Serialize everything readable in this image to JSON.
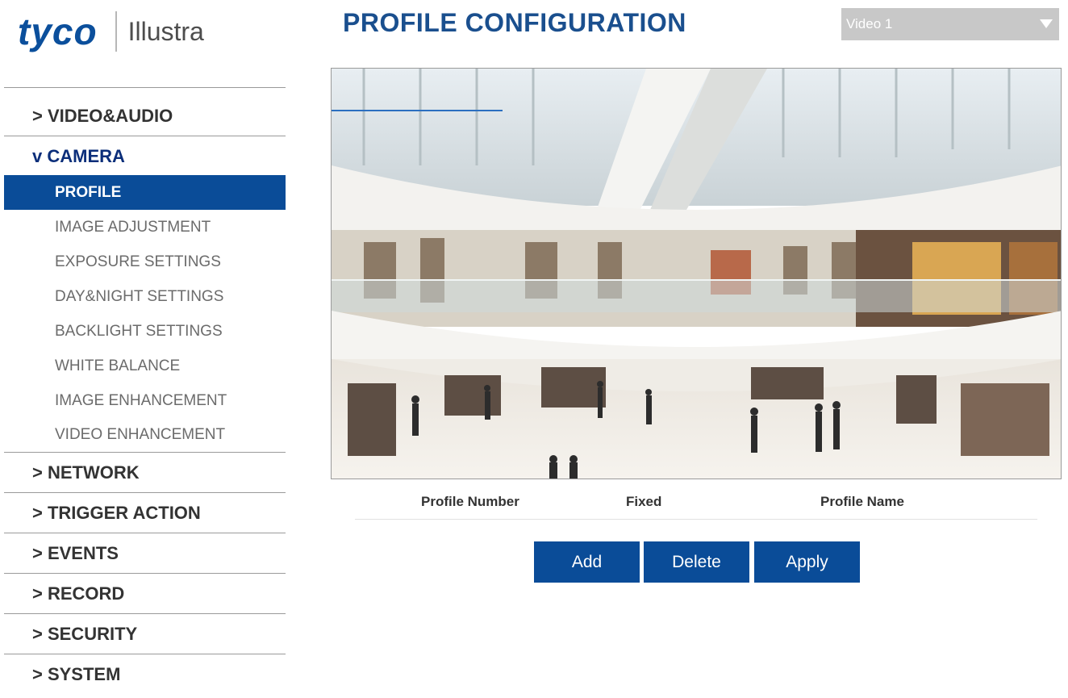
{
  "logo": {
    "brand": "tyco",
    "product": "Illustra"
  },
  "page_title": "PROFILE CONFIGURATION",
  "video_select": {
    "value": "Video 1"
  },
  "sidebar": {
    "sections_top": [
      {
        "label": "> VIDEO&AUDIO"
      }
    ],
    "camera": {
      "label": "v CAMERA",
      "items": [
        {
          "label": "PROFILE",
          "active": true
        },
        {
          "label": "IMAGE ADJUSTMENT"
        },
        {
          "label": "EXPOSURE SETTINGS"
        },
        {
          "label": "DAY&NIGHT SETTINGS"
        },
        {
          "label": "BACKLIGHT SETTINGS"
        },
        {
          "label": "WHITE BALANCE"
        },
        {
          "label": "IMAGE ENHANCEMENT"
        },
        {
          "label": "VIDEO ENHANCEMENT"
        }
      ]
    },
    "sections_bottom": [
      {
        "label": "> NETWORK"
      },
      {
        "label": "> TRIGGER ACTION"
      },
      {
        "label": "> EVENTS"
      },
      {
        "label": "> RECORD"
      },
      {
        "label": "> SECURITY"
      },
      {
        "label": "> SYSTEM"
      }
    ]
  },
  "table": {
    "headers": [
      "Profile Number",
      "Fixed",
      "Profile Name"
    ]
  },
  "buttons": {
    "add": "Add",
    "delete": "Delete",
    "apply": "Apply"
  },
  "colors": {
    "accent": "#0a4c98",
    "title": "#1a4f8e",
    "select_bg": "#c8c8c8"
  }
}
